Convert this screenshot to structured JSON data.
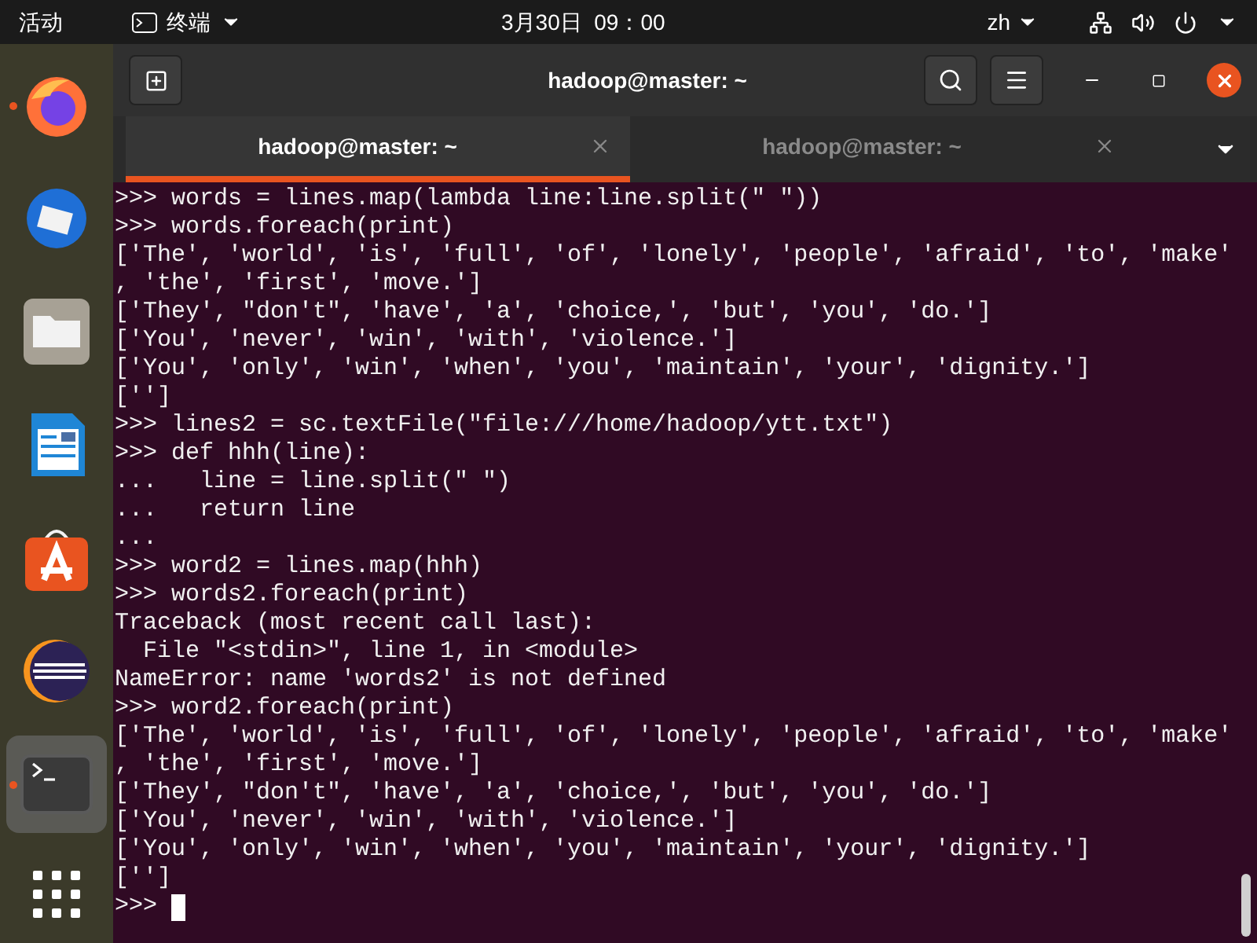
{
  "top_bar": {
    "activities": "活动",
    "app_menu": "终端",
    "clock": "3月30日  09：00",
    "input_method": "zh"
  },
  "dock": {
    "items": [
      {
        "kind": "firefox",
        "running": true,
        "selected": false
      },
      {
        "kind": "thunderbird",
        "running": false,
        "selected": false
      },
      {
        "kind": "files",
        "running": false,
        "selected": false
      },
      {
        "kind": "writer",
        "running": false,
        "selected": false
      },
      {
        "kind": "software",
        "running": false,
        "selected": false
      },
      {
        "kind": "eclipse",
        "running": false,
        "selected": false
      },
      {
        "kind": "terminal",
        "running": true,
        "selected": true
      }
    ]
  },
  "window": {
    "title": "hadoop@master: ~"
  },
  "tabs": [
    {
      "label": "hadoop@master: ~",
      "selected": true
    },
    {
      "label": "hadoop@master: ~",
      "selected": false
    }
  ],
  "terminal": {
    "lines": [
      ">>> words = lines.map(lambda line:line.split(\" \"))",
      ">>> words.foreach(print)",
      "['The', 'world', 'is', 'full', 'of', 'lonely', 'people', 'afraid', 'to', 'make'",
      ", 'the', 'first', 'move.']",
      "['They', \"don't\", 'have', 'a', 'choice,', 'but', 'you', 'do.']",
      "['You', 'never', 'win', 'with', 'violence.']",
      "['You', 'only', 'win', 'when', 'you', 'maintain', 'your', 'dignity.']",
      "['']",
      ">>> lines2 = sc.textFile(\"file:///home/hadoop/ytt.txt\")",
      ">>> def hhh(line):",
      "...   line = line.split(\" \")",
      "...   return line",
      "...",
      ">>> word2 = lines.map(hhh)",
      ">>> words2.foreach(print)",
      "Traceback (most recent call last):",
      "  File \"<stdin>\", line 1, in <module>",
      "NameError: name 'words2' is not defined",
      ">>> word2.foreach(print)",
      "['The', 'world', 'is', 'full', 'of', 'lonely', 'people', 'afraid', 'to', 'make'",
      ", 'the', 'first', 'move.']",
      "['They', \"don't\", 'have', 'a', 'choice,', 'but', 'you', 'do.']",
      "['You', 'never', 'win', 'with', 'violence.']",
      "['You', 'only', 'win', 'when', 'you', 'maintain', 'your', 'dignity.']",
      "['']"
    ],
    "prompt": ">>>"
  }
}
